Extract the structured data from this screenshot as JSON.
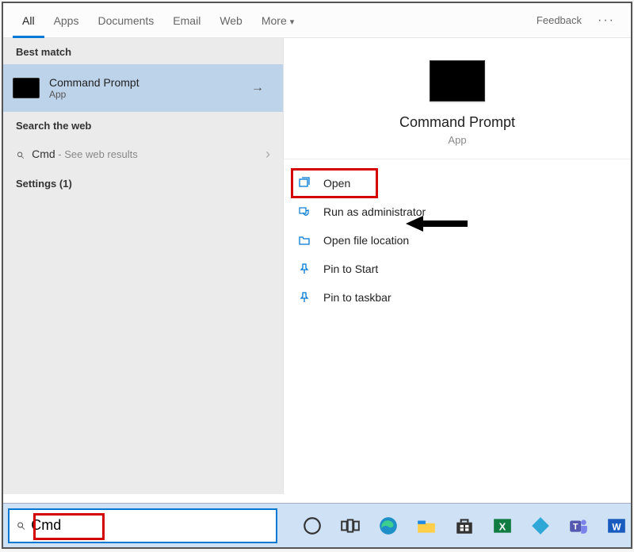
{
  "tabs": {
    "items": [
      "All",
      "Apps",
      "Documents",
      "Email",
      "Web",
      "More"
    ],
    "active_index": 0,
    "feedback_label": "Feedback"
  },
  "left": {
    "best_match_label": "Best match",
    "result": {
      "title": "Command Prompt",
      "subtitle": "App"
    },
    "search_web_label": "Search the web",
    "web_result": {
      "query": "Cmd",
      "suffix": " - See web results"
    },
    "settings_label": "Settings (1)"
  },
  "right": {
    "hero": {
      "title": "Command Prompt",
      "subtitle": "App"
    },
    "actions": [
      {
        "label": "Open",
        "icon": "open"
      },
      {
        "label": "Run as administrator",
        "icon": "admin"
      },
      {
        "label": "Open file location",
        "icon": "folder"
      },
      {
        "label": "Pin to Start",
        "icon": "pin"
      },
      {
        "label": "Pin to taskbar",
        "icon": "pin"
      }
    ]
  },
  "searchbar": {
    "value": "Cmd"
  },
  "taskbar_icons": [
    "cortana",
    "taskview",
    "edge",
    "explorer",
    "store",
    "excel",
    "kodi",
    "teams",
    "word"
  ]
}
